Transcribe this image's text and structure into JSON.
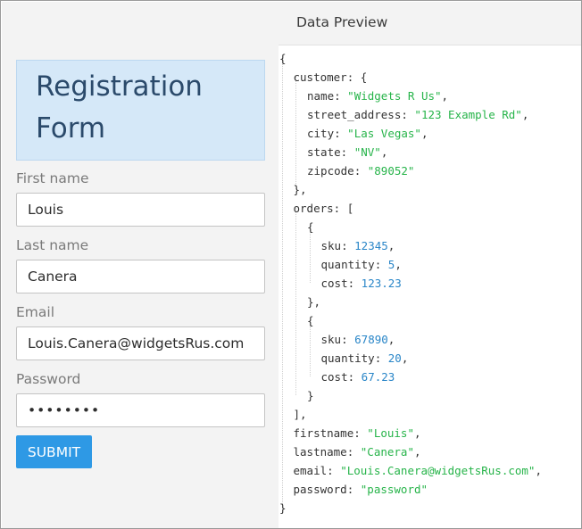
{
  "form": {
    "title": "Registration Form",
    "fields": [
      {
        "label": "First name",
        "value": "Louis"
      },
      {
        "label": "Last name",
        "value": "Canera"
      },
      {
        "label": "Email",
        "value": "Louis.Canera@widgetsRus.com"
      },
      {
        "label": "Password",
        "value": "password",
        "display": "••••••••"
      }
    ],
    "submit_label": "SUBMIT"
  },
  "preview": {
    "title": "Data Preview",
    "lines": [
      {
        "text": "{"
      },
      {
        "key": "customer",
        "punct": ": {"
      },
      {
        "key": "name",
        "str": "\"Widgets R Us\"",
        "punct": ","
      },
      {
        "key": "street_address",
        "str": "\"123 Example Rd\"",
        "punct": ","
      },
      {
        "key": "city",
        "str": "\"Las Vegas\"",
        "punct": ","
      },
      {
        "key": "state",
        "str": "\"NV\"",
        "punct": ","
      },
      {
        "key": "zipcode",
        "str": "\"89052\""
      },
      {
        "text": "},"
      },
      {
        "key": "orders",
        "punct": ": ["
      },
      {
        "text": "{"
      },
      {
        "key": "sku",
        "num": "12345",
        "punct": ","
      },
      {
        "key": "quantity",
        "num": "5",
        "punct": ","
      },
      {
        "key": "cost",
        "num": "123.23"
      },
      {
        "text": "},"
      },
      {
        "text": "{"
      },
      {
        "key": "sku",
        "num": "67890",
        "punct": ","
      },
      {
        "key": "quantity",
        "num": "20",
        "punct": ","
      },
      {
        "key": "cost",
        "num": "67.23"
      },
      {
        "text": "}"
      },
      {
        "text": "],"
      },
      {
        "key": "firstname",
        "str": "\"Louis\"",
        "punct": ","
      },
      {
        "key": "lastname",
        "str": "\"Canera\"",
        "punct": ","
      },
      {
        "key": "email",
        "str": "\"Louis.Canera@widgetsRus.com\"",
        "punct": ","
      },
      {
        "key": "password",
        "str": "\"password\""
      },
      {
        "text": "}"
      }
    ]
  },
  "colors": {
    "string": "#27b44a",
    "number": "#2a86c8",
    "submit": "#2e99e5",
    "title_box": "#d5e8f8"
  }
}
